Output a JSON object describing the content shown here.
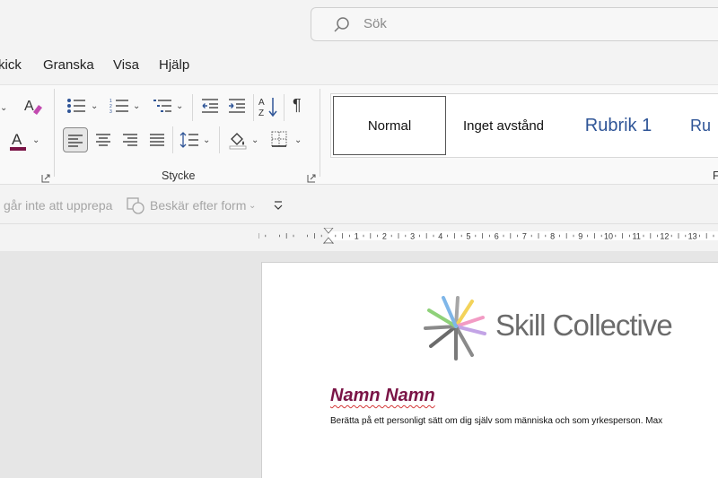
{
  "search": {
    "placeholder": "Sök"
  },
  "menu": {
    "items": [
      {
        "label": "kick"
      },
      {
        "label": "Granska"
      },
      {
        "label": "Visa"
      },
      {
        "label": "Hjälp"
      }
    ]
  },
  "ribbon": {
    "paragraph_group_label": "Stycke",
    "font_color_hex": "#7a1446",
    "styles": {
      "normal": "Normal",
      "no_spacing": "Inget avstånd",
      "heading1": "Rubrik 1",
      "heading2": "Ru",
      "next_group_letter": "F"
    }
  },
  "quick_access": {
    "repeat_label": "går inte att upprepa",
    "crop_label": "Beskär efter form"
  },
  "ruler": {
    "numbers": [
      "1",
      "2",
      "3",
      "4",
      "5",
      "6",
      "7",
      "8",
      "9",
      "10",
      "11",
      "12",
      "13"
    ]
  },
  "document": {
    "logo_text": "Skill Collective",
    "name": "Namn Namn",
    "body": "Berätta på ett personligt sätt om dig själv som människa och som yrkesperson. Max"
  }
}
